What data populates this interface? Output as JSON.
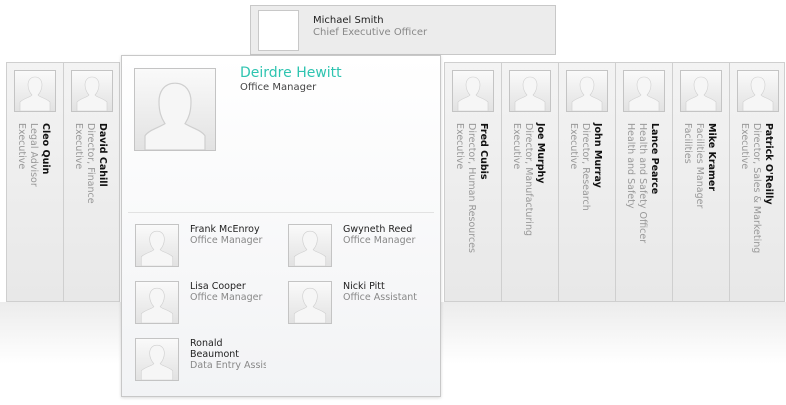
{
  "ceo": {
    "name": "Michael Smith",
    "title": "Chief Executive Officer"
  },
  "columns_left": [
    {
      "name": "Cleo Quin",
      "title": "Legal Advisor",
      "dept": "Executive"
    },
    {
      "name": "David Cahill",
      "title": "Director, Finance",
      "dept": "Executive"
    }
  ],
  "columns_right": [
    {
      "name": "Fred Cubis",
      "title": "Director, Human Resources",
      "dept": "Executive"
    },
    {
      "name": "Joe Murphy",
      "title": "Director, Manufacturing",
      "dept": "Executive"
    },
    {
      "name": "John Murray",
      "title": "Director, Research",
      "dept": "Executive"
    },
    {
      "name": "Lance Pearce",
      "title": "Health and Safety Officer",
      "dept": "Health and Safety"
    },
    {
      "name": "Mike Kramer",
      "title": "Facilities Manager",
      "dept": "Facilities"
    },
    {
      "name": "Patrick O'Reilly",
      "title": "Director, Sales & Marketing",
      "dept": "Executive"
    }
  ],
  "expanded": {
    "name": "Deirdre Hewitt",
    "title": "Office Manager",
    "accent": "#2ec4b0",
    "reports": [
      {
        "name": "Frank McEnroy",
        "title": "Office Manager"
      },
      {
        "name": "Gwyneth Reed",
        "title": "Office Manager"
      },
      {
        "name": "Lisa Cooper",
        "title": "Office Manager"
      },
      {
        "name": "Nicki Pitt",
        "title": "Office Assistant"
      },
      {
        "name": "Ronald Beaumont",
        "title": "Data Entry Assistant"
      }
    ]
  }
}
